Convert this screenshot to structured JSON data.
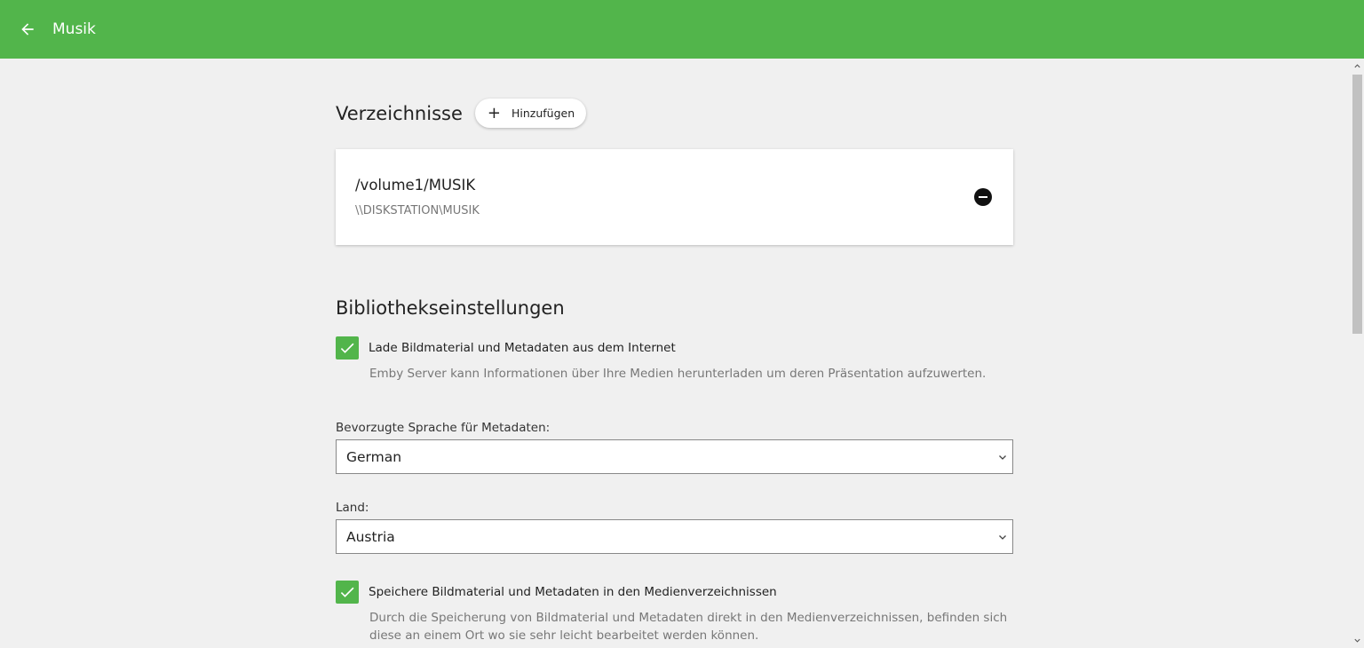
{
  "header": {
    "title": "Musik",
    "back_icon": "arrow-left-icon",
    "color": "#52b54b"
  },
  "folders": {
    "title": "Verzeichnisse",
    "add_label": "Hinzufügen",
    "items": [
      {
        "path": "/volume1/MUSIK",
        "network_path": "\\\\DISKSTATION\\MUSIK"
      }
    ]
  },
  "library": {
    "title": "Bibliothekseinstellungen",
    "download_metadata": {
      "label": "Lade Bildmaterial und Metadaten aus dem Internet",
      "description": "Emby Server kann Informationen über Ihre Medien herunterladen um deren Präsentation aufzuwerten.",
      "checked": true
    },
    "language": {
      "label": "Bevorzugte Sprache für Metadaten:",
      "value": "German"
    },
    "country": {
      "label": "Land:",
      "value": "Austria"
    },
    "save_local": {
      "label": "Speichere Bildmaterial und Metadaten in den Medienverzeichnissen",
      "description": "Durch die Speicherung von Bildmaterial und Metadaten direkt in den Medienverzeichnissen, befinden sich diese an einem Ort wo sie sehr leicht bearbeitet werden können.",
      "checked": true
    }
  }
}
